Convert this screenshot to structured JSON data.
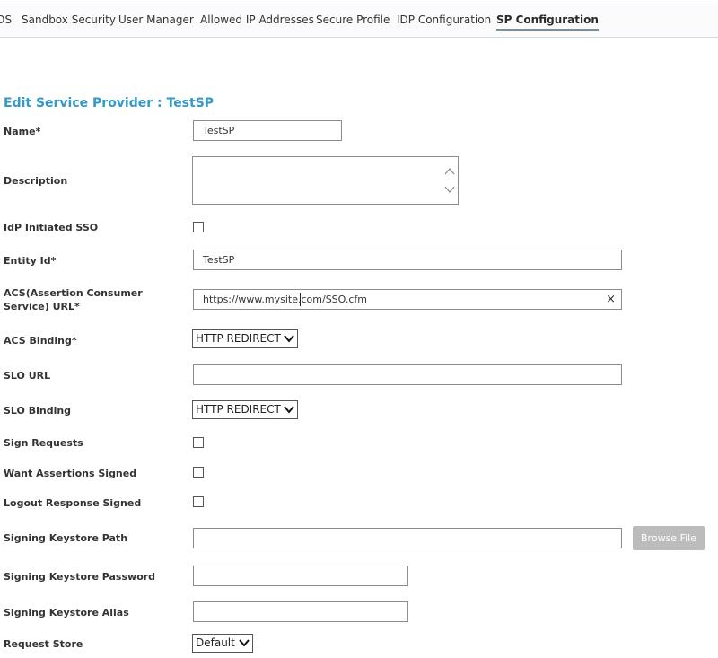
{
  "tabs": [
    {
      "label": "OS"
    },
    {
      "label": "Sandbox Security"
    },
    {
      "label": "User Manager"
    },
    {
      "label": "Allowed IP Addresses"
    },
    {
      "label": "Secure Profile"
    },
    {
      "label": "IDP Configuration"
    },
    {
      "label": "SP Configuration",
      "active": true
    }
  ],
  "page_title": "Edit Service Provider : TestSP",
  "fields": {
    "name": {
      "label": "Name*",
      "value": "TestSP"
    },
    "description": {
      "label": "Description",
      "value": ""
    },
    "idp_initiated_sso": {
      "label": "IdP Initiated SSO",
      "checked": false
    },
    "entity_id": {
      "label": "Entity Id*",
      "value": "TestSP"
    },
    "acs_url": {
      "label": "ACS(Assertion Consumer Service) URL*",
      "value": "https://www.mysite.com/SSO.cfm",
      "clear": "×"
    },
    "acs_binding": {
      "label": "ACS Binding*",
      "value": "HTTP REDIRECT"
    },
    "slo_url": {
      "label": "SLO URL",
      "value": ""
    },
    "slo_binding": {
      "label": "SLO Binding",
      "value": "HTTP REDIRECT"
    },
    "sign_requests": {
      "label": "Sign Requests",
      "checked": false
    },
    "want_assertions_signed": {
      "label": "Want Assertions Signed",
      "checked": false
    },
    "logout_response_signed": {
      "label": "Logout Response Signed",
      "checked": false
    },
    "signing_keystore_path": {
      "label": "Signing Keystore Path",
      "value": "",
      "browse": "Browse File"
    },
    "signing_keystore_password": {
      "label": "Signing Keystore Password",
      "value": ""
    },
    "signing_keystore_alias": {
      "label": "Signing Keystore Alias",
      "value": ""
    },
    "request_store": {
      "label": "Request Store",
      "value": "Default"
    }
  },
  "colors": {
    "title": "#3498c8",
    "button_bg": "#bcbcbc",
    "tab_underline": "#7c8f9a"
  }
}
